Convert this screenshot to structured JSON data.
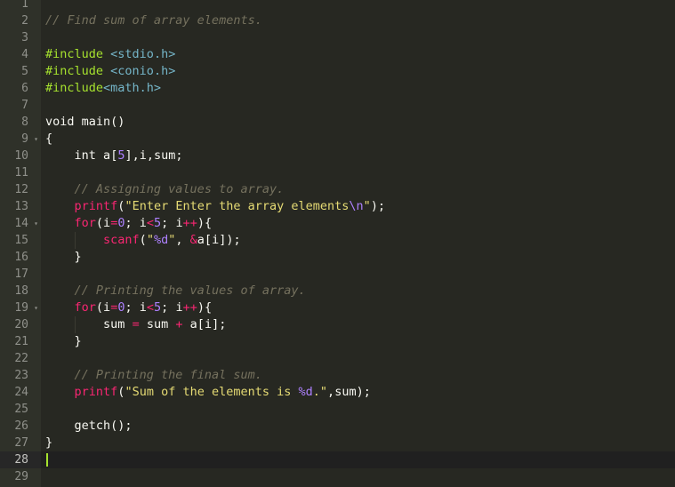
{
  "editor": {
    "colors": {
      "background": "#272822",
      "gutter": "#2f3129",
      "text": "#f8f8f2",
      "comment": "#75715e",
      "keyword": "#f92672",
      "string": "#e6db74",
      "number": "#ae81ff",
      "preprocessor": "#a6e22e",
      "header": "#75b5c8",
      "cursor": "#a6e22e"
    },
    "active_line": 28,
    "fold_marker_lines": [
      9,
      14,
      19
    ],
    "lines": [
      {
        "n": "1",
        "tokens": []
      },
      {
        "n": "2",
        "tokens": [
          {
            "t": "comment",
            "v": "// Find sum of array elements."
          }
        ]
      },
      {
        "n": "3",
        "tokens": []
      },
      {
        "n": "4",
        "tokens": [
          {
            "t": "pp",
            "v": "#include"
          },
          {
            "t": "ws",
            "v": " "
          },
          {
            "t": "hdr",
            "v": "<stdio.h>"
          }
        ]
      },
      {
        "n": "5",
        "tokens": [
          {
            "t": "pp",
            "v": "#include"
          },
          {
            "t": "ws",
            "v": " "
          },
          {
            "t": "hdr",
            "v": "<conio.h>"
          }
        ]
      },
      {
        "n": "6",
        "tokens": [
          {
            "t": "pp",
            "v": "#include"
          },
          {
            "t": "hdr",
            "v": "<math.h>"
          }
        ]
      },
      {
        "n": "7",
        "tokens": []
      },
      {
        "n": "8",
        "tokens": [
          {
            "t": "kw",
            "v": "void"
          },
          {
            "t": "ws",
            "v": " "
          },
          {
            "t": "id",
            "v": "main"
          },
          {
            "t": "punc",
            "v": "()"
          }
        ]
      },
      {
        "n": "9",
        "tokens": [
          {
            "t": "punc",
            "v": "{"
          }
        ]
      },
      {
        "n": "10",
        "tokens": [
          {
            "t": "ws",
            "v": "    "
          },
          {
            "t": "kw",
            "v": "int"
          },
          {
            "t": "ws",
            "v": " "
          },
          {
            "t": "id",
            "v": "a"
          },
          {
            "t": "punc",
            "v": "["
          },
          {
            "t": "num",
            "v": "5"
          },
          {
            "t": "punc",
            "v": "],"
          },
          {
            "t": "id",
            "v": "i"
          },
          {
            "t": "punc",
            "v": ","
          },
          {
            "t": "id",
            "v": "sum"
          },
          {
            "t": "punc",
            "v": ";"
          }
        ]
      },
      {
        "n": "11",
        "tokens": []
      },
      {
        "n": "12",
        "tokens": [
          {
            "t": "ws",
            "v": "    "
          },
          {
            "t": "comment",
            "v": "// Assigning values to array."
          }
        ]
      },
      {
        "n": "13",
        "tokens": [
          {
            "t": "ws",
            "v": "    "
          },
          {
            "t": "fn",
            "v": "printf"
          },
          {
            "t": "punc",
            "v": "("
          },
          {
            "t": "str",
            "v": "\"Enter Enter the array elements"
          },
          {
            "t": "esc",
            "v": "\\n"
          },
          {
            "t": "str",
            "v": "\""
          },
          {
            "t": "punc",
            "v": ");"
          }
        ]
      },
      {
        "n": "14",
        "tokens": [
          {
            "t": "ws",
            "v": "    "
          },
          {
            "t": "ctl",
            "v": "for"
          },
          {
            "t": "punc",
            "v": "("
          },
          {
            "t": "id",
            "v": "i"
          },
          {
            "t": "op",
            "v": "="
          },
          {
            "t": "num",
            "v": "0"
          },
          {
            "t": "punc",
            "v": ";"
          },
          {
            "t": "ws",
            "v": " "
          },
          {
            "t": "id",
            "v": "i"
          },
          {
            "t": "op",
            "v": "<"
          },
          {
            "t": "num",
            "v": "5"
          },
          {
            "t": "punc",
            "v": ";"
          },
          {
            "t": "ws",
            "v": " "
          },
          {
            "t": "id",
            "v": "i"
          },
          {
            "t": "op",
            "v": "++"
          },
          {
            "t": "punc",
            "v": "){"
          }
        ]
      },
      {
        "n": "15",
        "tokens": [
          {
            "t": "ws",
            "v": "        "
          },
          {
            "t": "fn",
            "v": "scanf"
          },
          {
            "t": "punc",
            "v": "("
          },
          {
            "t": "str",
            "v": "\""
          },
          {
            "t": "esc",
            "v": "%d"
          },
          {
            "t": "str",
            "v": "\""
          },
          {
            "t": "punc",
            "v": ","
          },
          {
            "t": "ws",
            "v": " "
          },
          {
            "t": "op",
            "v": "&"
          },
          {
            "t": "id",
            "v": "a"
          },
          {
            "t": "punc",
            "v": "["
          },
          {
            "t": "id",
            "v": "i"
          },
          {
            "t": "punc",
            "v": "]);"
          }
        ]
      },
      {
        "n": "16",
        "tokens": [
          {
            "t": "ws",
            "v": "    "
          },
          {
            "t": "punc",
            "v": "}"
          }
        ]
      },
      {
        "n": "17",
        "tokens": []
      },
      {
        "n": "18",
        "tokens": [
          {
            "t": "ws",
            "v": "    "
          },
          {
            "t": "comment",
            "v": "// Printing the values of array."
          }
        ]
      },
      {
        "n": "19",
        "tokens": [
          {
            "t": "ws",
            "v": "    "
          },
          {
            "t": "ctl",
            "v": "for"
          },
          {
            "t": "punc",
            "v": "("
          },
          {
            "t": "id",
            "v": "i"
          },
          {
            "t": "op",
            "v": "="
          },
          {
            "t": "num",
            "v": "0"
          },
          {
            "t": "punc",
            "v": ";"
          },
          {
            "t": "ws",
            "v": " "
          },
          {
            "t": "id",
            "v": "i"
          },
          {
            "t": "op",
            "v": "<"
          },
          {
            "t": "num",
            "v": "5"
          },
          {
            "t": "punc",
            "v": ";"
          },
          {
            "t": "ws",
            "v": " "
          },
          {
            "t": "id",
            "v": "i"
          },
          {
            "t": "op",
            "v": "++"
          },
          {
            "t": "punc",
            "v": "){"
          }
        ]
      },
      {
        "n": "20",
        "tokens": [
          {
            "t": "ws",
            "v": "        "
          },
          {
            "t": "id",
            "v": "sum"
          },
          {
            "t": "ws",
            "v": " "
          },
          {
            "t": "op",
            "v": "="
          },
          {
            "t": "ws",
            "v": " "
          },
          {
            "t": "id",
            "v": "sum"
          },
          {
            "t": "ws",
            "v": " "
          },
          {
            "t": "op",
            "v": "+"
          },
          {
            "t": "ws",
            "v": " "
          },
          {
            "t": "id",
            "v": "a"
          },
          {
            "t": "punc",
            "v": "["
          },
          {
            "t": "id",
            "v": "i"
          },
          {
            "t": "punc",
            "v": "];"
          }
        ]
      },
      {
        "n": "21",
        "tokens": [
          {
            "t": "ws",
            "v": "    "
          },
          {
            "t": "punc",
            "v": "}"
          }
        ]
      },
      {
        "n": "22",
        "tokens": []
      },
      {
        "n": "23",
        "tokens": [
          {
            "t": "ws",
            "v": "    "
          },
          {
            "t": "comment",
            "v": "// Printing the final sum."
          }
        ]
      },
      {
        "n": "24",
        "tokens": [
          {
            "t": "ws",
            "v": "    "
          },
          {
            "t": "fn",
            "v": "printf"
          },
          {
            "t": "punc",
            "v": "("
          },
          {
            "t": "str",
            "v": "\"Sum of the elements is "
          },
          {
            "t": "esc",
            "v": "%d"
          },
          {
            "t": "str",
            "v": ".\""
          },
          {
            "t": "punc",
            "v": ","
          },
          {
            "t": "id",
            "v": "sum"
          },
          {
            "t": "punc",
            "v": ");"
          }
        ]
      },
      {
        "n": "25",
        "tokens": []
      },
      {
        "n": "26",
        "tokens": [
          {
            "t": "ws",
            "v": "    "
          },
          {
            "t": "id",
            "v": "getch"
          },
          {
            "t": "punc",
            "v": "();"
          }
        ]
      },
      {
        "n": "27",
        "tokens": [
          {
            "t": "punc",
            "v": "}"
          }
        ]
      },
      {
        "n": "28",
        "tokens": []
      },
      {
        "n": "29",
        "tokens": []
      }
    ]
  }
}
